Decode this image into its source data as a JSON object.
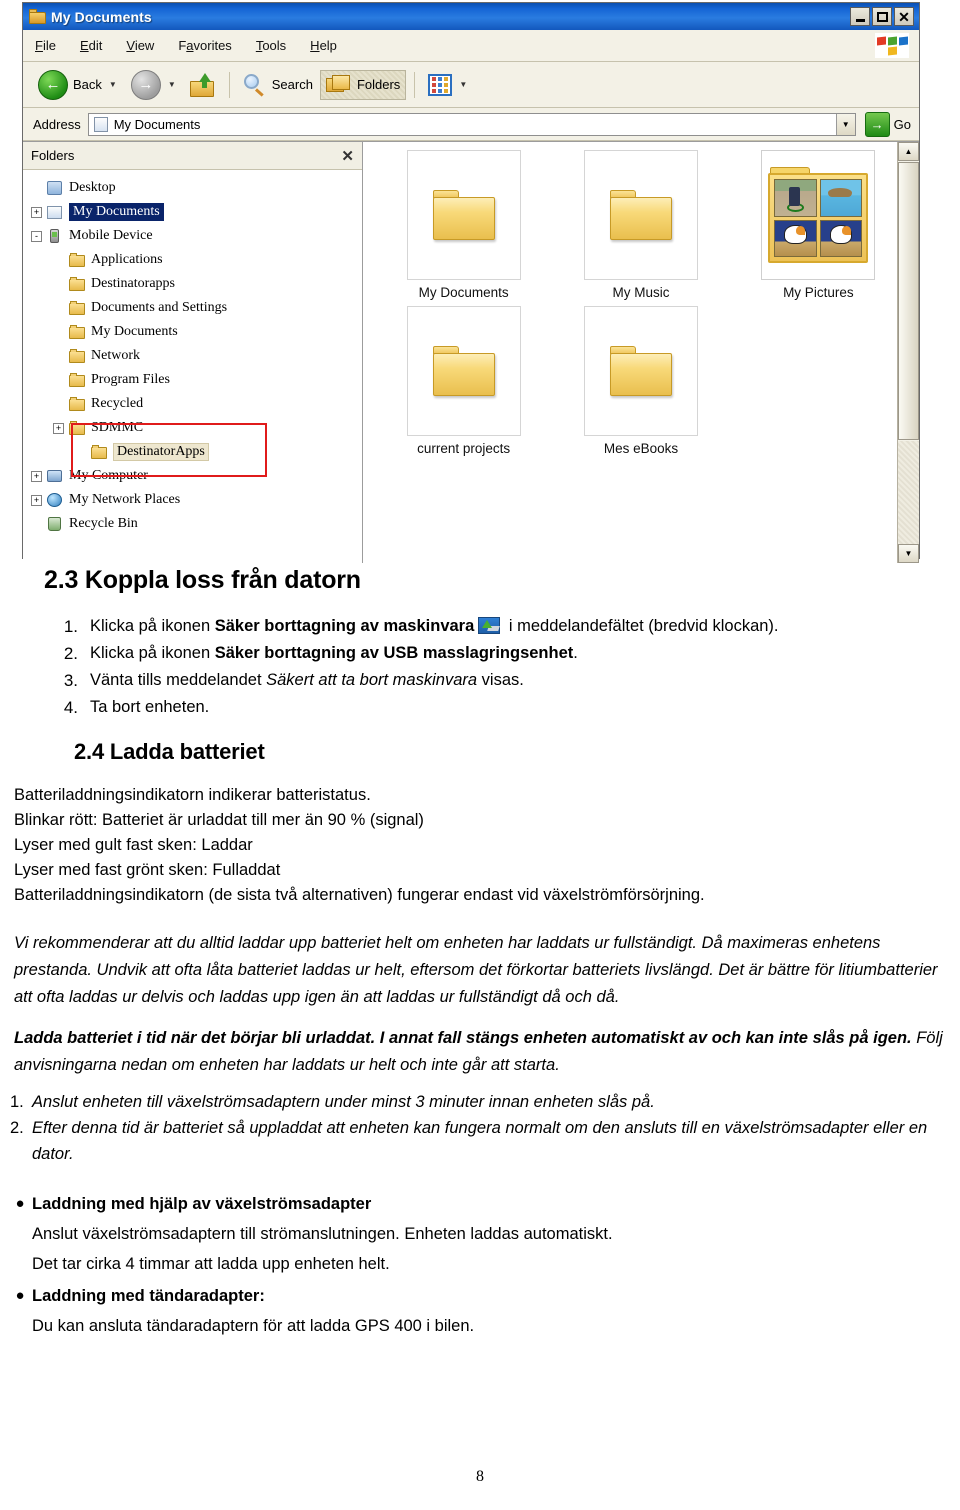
{
  "explorer": {
    "title": "My Documents",
    "window_buttons": {
      "minimize": "_",
      "maximize": "□",
      "close": "X"
    },
    "menu": [
      "File",
      "Edit",
      "View",
      "Favorites",
      "Tools",
      "Help"
    ],
    "toolbar": {
      "back": "Back",
      "forward": "",
      "up": "",
      "search": "Search",
      "folders": "Folders",
      "views": ""
    },
    "address": {
      "label": "Address",
      "value": "My Documents",
      "go": "Go"
    },
    "folders_pane": {
      "header": "Folders",
      "close": "✕",
      "tree": [
        {
          "label": "Desktop",
          "indent": 0,
          "expander": "",
          "icon": "desktop-icon",
          "state": "normal"
        },
        {
          "label": "My Documents",
          "indent": 0,
          "expander": "+",
          "icon": "document-icon",
          "state": "selected"
        },
        {
          "label": "Mobile Device",
          "indent": 0,
          "expander": "-",
          "icon": "mobile-device-icon",
          "state": "normal"
        },
        {
          "label": "Applications",
          "indent": 1,
          "expander": "",
          "icon": "folder-icon",
          "state": "normal"
        },
        {
          "label": "Destinatorapps",
          "indent": 1,
          "expander": "",
          "icon": "folder-icon",
          "state": "normal"
        },
        {
          "label": "Documents and Settings",
          "indent": 1,
          "expander": "",
          "icon": "folder-icon",
          "state": "normal"
        },
        {
          "label": "My Documents",
          "indent": 1,
          "expander": "",
          "icon": "folder-icon",
          "state": "normal"
        },
        {
          "label": "Network",
          "indent": 1,
          "expander": "",
          "icon": "folder-icon",
          "state": "normal"
        },
        {
          "label": "Program Files",
          "indent": 1,
          "expander": "",
          "icon": "folder-icon",
          "state": "normal"
        },
        {
          "label": "Recycled",
          "indent": 1,
          "expander": "",
          "icon": "folder-icon",
          "state": "normal"
        },
        {
          "label": "SDMMC",
          "indent": 1,
          "expander": "+",
          "icon": "folder-icon",
          "state": "normal"
        },
        {
          "label": "DestinatorApps",
          "indent": 2,
          "expander": "",
          "icon": "folder-icon",
          "state": "softselected"
        },
        {
          "label": "My Computer",
          "indent": 0,
          "expander": "+",
          "icon": "computer-icon",
          "state": "normal"
        },
        {
          "label": "My Network Places",
          "indent": 0,
          "expander": "+",
          "icon": "network-icon",
          "state": "normal"
        },
        {
          "label": "Recycle Bin",
          "indent": 0,
          "expander": "",
          "icon": "recycle-bin-icon",
          "state": "normal"
        }
      ],
      "annotation_color": "#e01b1b"
    },
    "files": [
      {
        "label": "My Documents",
        "type": "folder"
      },
      {
        "label": "My Music",
        "type": "folder"
      },
      {
        "label": "My Pictures",
        "type": "picture-folder"
      },
      {
        "label": "current projects",
        "type": "folder"
      },
      {
        "label": "Mes eBooks",
        "type": "folder"
      }
    ]
  },
  "doc": {
    "section_23_title": "2.3 Koppla loss från datorn",
    "steps_23": [
      {
        "num": "1.",
        "pre": "Klicka på ikonen ",
        "bold": "Säker borttagning av maskinvara",
        "has_icon": true,
        "post": " i meddelandefältet (bredvid klockan)."
      },
      {
        "num": "2.",
        "pre": "Klicka på ikonen ",
        "bold": "Säker borttagning av USB masslagringsenhet",
        "has_icon": false,
        "post": "."
      },
      {
        "num": "3.",
        "pre": "Vänta tills meddelandet ",
        "italic": "Säkert att ta bort maskinvara",
        "has_icon": false,
        "post": " visas."
      },
      {
        "num": "4.",
        "pre": "Ta bort enheten.",
        "has_icon": false,
        "post": ""
      }
    ],
    "section_24_title": "2.4 Ladda batteriet",
    "battery_intro": "Batteriladdningsindikatorn indikerar batteristatus.",
    "battery_states": [
      "Blinkar rött: Batteriet är urladdat till mer än 90 % (signal)",
      "Lyser med gult fast sken: Laddar",
      "Lyser med fast grönt sken: Fulladdat"
    ],
    "battery_note": "Batteriladdningsindikatorn (de sista två alternativen) fungerar endast vid växelströmförsörjning.",
    "recommendation": "Vi rekommenderar att du alltid laddar upp batteriet helt om enheten har laddats ur fullständigt. Då maximeras enhetens prestanda. Undvik att ofta låta batteriet laddas ur helt, eftersom det förkortar batteriets livslängd. Det är bättre för litiumbatterier att ofta laddas ur delvis och laddas upp igen än att laddas ur fullständigt då och då.",
    "warning_bold": "Ladda batteriet i tid när det börjar bli urladdat. I annat fall stängs enheten automatiskt av och kan inte slås på igen.",
    "warning_rest": " Följ anvisningarna nedan om enheten har laddats ur helt och inte går att starta.",
    "recovery_steps": [
      {
        "num": "1.",
        "text": "Anslut enheten till växelströmsadaptern under minst 3 minuter innan enheten slås på."
      },
      {
        "num": "2.",
        "text": "Efter denna tid är batteriet så uppladdat att enheten kan fungera normalt om den ansluts till en växelströmsadapter eller en dator."
      }
    ],
    "charging_options": [
      {
        "heading": "Laddning med hjälp av växelströmsadapter",
        "lines": [
          "Anslut växelströmsadaptern till strömanslutningen. Enheten laddas automatiskt.",
          "Det tar cirka 4 timmar att ladda upp enheten helt."
        ]
      },
      {
        "heading": "Laddning med tändaradapter:",
        "lines": [
          "Du kan ansluta tändaradaptern för att ladda GPS 400 i bilen."
        ]
      }
    ],
    "page_number": "8"
  }
}
